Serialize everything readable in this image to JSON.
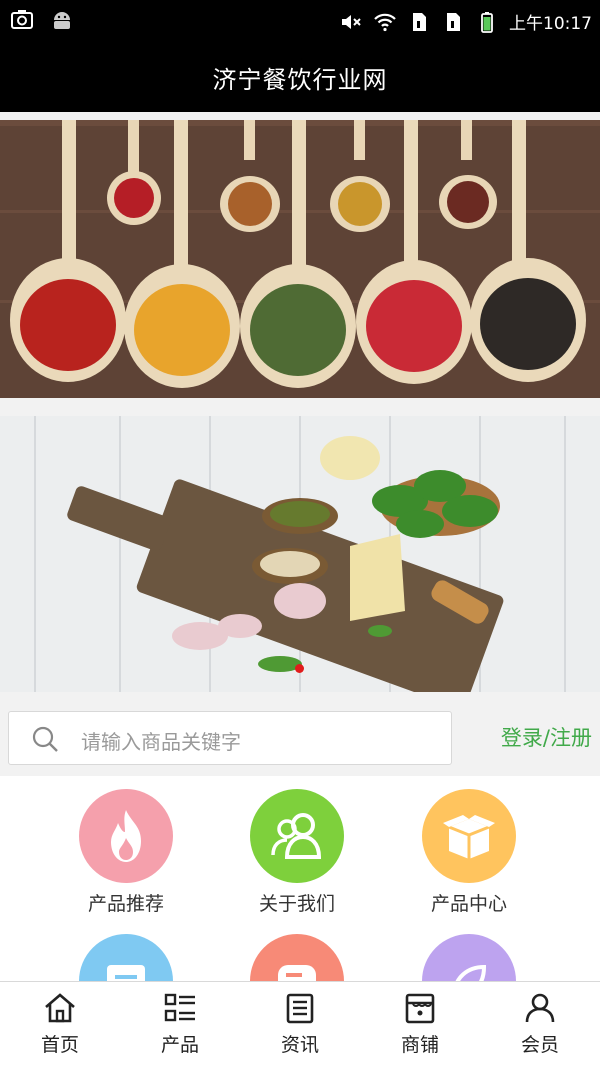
{
  "status_bar": {
    "time": "上午10:17",
    "icons": [
      "camera-icon",
      "android-icon",
      "mute-icon",
      "wifi-icon",
      "sim1-icon",
      "sim2-icon",
      "battery-icon"
    ]
  },
  "header": {
    "title": "济宁餐饮行业网"
  },
  "search": {
    "placeholder": "请输入商品关键字",
    "login_label": "登录/注册"
  },
  "categories": [
    {
      "label": "产品推荐",
      "icon": "flame-icon",
      "color": "#f5a0ac"
    },
    {
      "label": "关于我们",
      "icon": "users-icon",
      "color": "#7ed03c"
    },
    {
      "label": "产品中心",
      "icon": "box-icon",
      "color": "#ffc45e"
    },
    {
      "label": "",
      "icon": "message-icon",
      "color": "#7fc9f2"
    },
    {
      "label": "",
      "icon": "chat-icon",
      "color": "#f78a77"
    },
    {
      "label": "",
      "icon": "leaf-icon",
      "color": "#bda3ef"
    }
  ],
  "tabs": [
    {
      "label": "首页",
      "icon": "home-icon"
    },
    {
      "label": "产品",
      "icon": "list-icon"
    },
    {
      "label": "资讯",
      "icon": "news-icon"
    },
    {
      "label": "商铺",
      "icon": "store-icon"
    },
    {
      "label": "会员",
      "icon": "user-icon"
    }
  ]
}
